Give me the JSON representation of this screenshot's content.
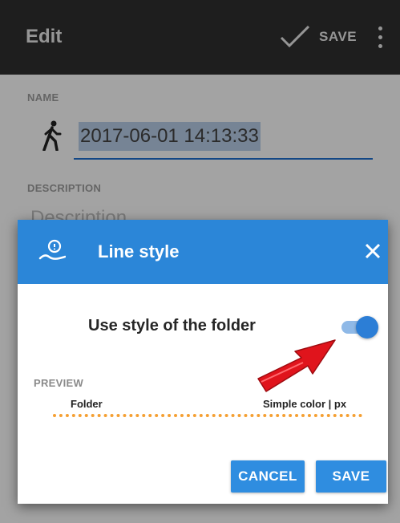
{
  "appbar": {
    "title": "Edit",
    "save_label": "SAVE",
    "icons": [
      "check-icon",
      "overflow-menu-icon"
    ]
  },
  "form": {
    "name_label": "NAME",
    "name_value": "2017-06-01 14:13:33",
    "description_label": "DESCRIPTION",
    "description_placeholder": "Description",
    "icons": [
      "walking-person-icon"
    ]
  },
  "dialog": {
    "title": "Line style",
    "toggle_label": "Use style of the folder",
    "toggle_on": true,
    "preview_label": "PREVIEW",
    "preview_left": "Folder",
    "preview_right": "Simple color | px",
    "cancel_label": "CANCEL",
    "save_label": "SAVE",
    "icons": [
      "route-icon",
      "close-icon",
      "red-arrow-icon"
    ]
  },
  "colors": {
    "appbar_bg": "#2f2f2f",
    "dialog_header": "#2b86d8",
    "button_bg": "#2f8de0",
    "preview_line": "#f5a033",
    "arrow": "#e0141c"
  }
}
